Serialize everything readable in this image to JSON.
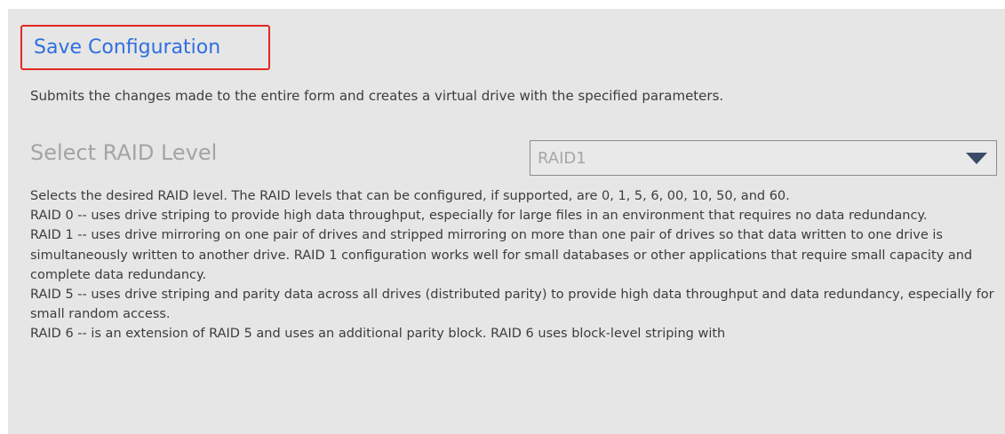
{
  "save": {
    "link_label": "Save Configuration",
    "description": "Submits the changes made to the entire form and creates a virtual drive with the specified parameters."
  },
  "raid": {
    "label": "Select RAID Level",
    "selected": "RAID1",
    "paragraphs": [
      "Selects the desired RAID level. The RAID levels that can be configured, if supported, are 0, 1, 5, 6, 00, 10, 50, and 60.",
      "RAID 0 -- uses drive striping to provide high data throughput, especially for large files in an environment that requires no data redundancy.",
      "RAID 1 -- uses drive mirroring on one pair of drives and stripped mirroring on more than one pair of drives so that data written to one drive is simultaneously written to another drive. RAID 1 configuration works well for small databases or other applications that require small capacity and complete data redundancy.",
      "RAID 5 -- uses drive striping and parity data across all drives (distributed parity) to provide high data throughput and data redundancy, especially for small random access.",
      "RAID 6 -- is an extension of RAID 5 and uses an additional parity block. RAID 6 uses block-level striping with"
    ]
  },
  "colors": {
    "link": "#2f6fe0",
    "highlight_border": "#e22822",
    "panel_background": "#e6e6e6",
    "dropdown_arrow": "#3a4b67"
  },
  "icons": {
    "dropdown": "triangle-down"
  }
}
